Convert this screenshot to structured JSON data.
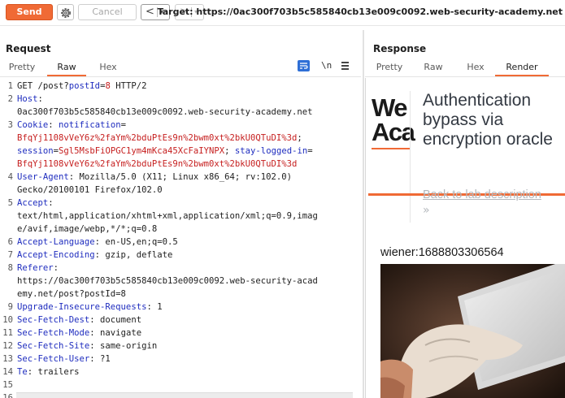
{
  "toolbar": {
    "send_label": "Send",
    "cancel_label": "Cancel",
    "back_arrow": "<",
    "forward_arrow": ">",
    "dropdown_caret": "▾",
    "target_text": "Target: https://0ac300f703b5c585840cb13e009c0092.web-security-academy.net"
  },
  "request": {
    "title": "Request",
    "tabs": [
      "Pretty",
      "Raw",
      "Hex"
    ],
    "active_tab": "Raw",
    "newline_toggle": "\\n",
    "lines": [
      {
        "num": "1",
        "parts": [
          [
            "GET /post?",
            ""
          ],
          [
            "postId",
            "pn"
          ],
          [
            "=",
            ""
          ],
          [
            "8",
            "pv"
          ],
          [
            " HTTP/2",
            ""
          ]
        ]
      },
      {
        "num": "2",
        "parts": [
          [
            "Host",
            "hn"
          ],
          [
            ":",
            ""
          ]
        ]
      },
      {
        "num": "",
        "parts": [
          [
            "0ac300f703b5c585840cb13e009c0092.web-security-academy.net",
            ""
          ]
        ]
      },
      {
        "num": "3",
        "parts": [
          [
            "Cookie",
            "hn"
          ],
          [
            ": ",
            ""
          ],
          [
            "notification",
            "ck"
          ],
          [
            "=",
            ""
          ]
        ]
      },
      {
        "num": "",
        "parts": [
          [
            "BfqYj1108vVeY6z%2faYm%2bduPtEs9n%2bwm0xt%2bkU0QTuDI%3d",
            "cv"
          ],
          [
            ";",
            ""
          ]
        ]
      },
      {
        "num": "",
        "parts": [
          [
            "session",
            "ck"
          ],
          [
            "=",
            ""
          ],
          [
            "Sgl5MsbFiOPGC1ym4mKca45XcFaIYNPX",
            "cv"
          ],
          [
            "; ",
            ""
          ],
          [
            "stay-logged-in",
            "ck"
          ],
          [
            "=",
            ""
          ]
        ]
      },
      {
        "num": "",
        "parts": [
          [
            "BfqYj1108vVeY6z%2faYm%2bduPtEs9n%2bwm0xt%2bkU0QTuDI%3d",
            "cv"
          ]
        ]
      },
      {
        "num": "4",
        "parts": [
          [
            "User-Agent",
            "hn"
          ],
          [
            ": Mozilla/5.0 (X11; Linux x86_64; rv:102.0)",
            ""
          ]
        ]
      },
      {
        "num": "",
        "parts": [
          [
            "Gecko/20100101 Firefox/102.0",
            ""
          ]
        ]
      },
      {
        "num": "5",
        "parts": [
          [
            "Accept",
            "hn"
          ],
          [
            ":",
            ""
          ]
        ]
      },
      {
        "num": "",
        "parts": [
          [
            "text/html,application/xhtml+xml,application/xml;q=0.9,imag",
            ""
          ]
        ]
      },
      {
        "num": "",
        "parts": [
          [
            "e/avif,image/webp,*/*;q=0.8",
            ""
          ]
        ]
      },
      {
        "num": "6",
        "parts": [
          [
            "Accept-Language",
            "hn"
          ],
          [
            ": en-US,en;q=0.5",
            ""
          ]
        ]
      },
      {
        "num": "7",
        "parts": [
          [
            "Accept-Encoding",
            "hn"
          ],
          [
            ": gzip, deflate",
            ""
          ]
        ]
      },
      {
        "num": "8",
        "parts": [
          [
            "Referer",
            "hn"
          ],
          [
            ":",
            ""
          ]
        ]
      },
      {
        "num": "",
        "parts": [
          [
            "https://0ac300f703b5c585840cb13e009c0092.web-security-acad",
            ""
          ]
        ]
      },
      {
        "num": "",
        "parts": [
          [
            "emy.net/post?postId=8",
            ""
          ]
        ]
      },
      {
        "num": "9",
        "parts": [
          [
            "Upgrade-Insecure-Requests",
            "hn"
          ],
          [
            ": 1",
            ""
          ]
        ]
      },
      {
        "num": "10",
        "parts": [
          [
            "Sec-Fetch-Dest",
            "hn"
          ],
          [
            ": document",
            ""
          ]
        ]
      },
      {
        "num": "11",
        "parts": [
          [
            "Sec-Fetch-Mode",
            "hn"
          ],
          [
            ": navigate",
            ""
          ]
        ]
      },
      {
        "num": "12",
        "parts": [
          [
            "Sec-Fetch-Site",
            "hn"
          ],
          [
            ": same-origin",
            ""
          ]
        ]
      },
      {
        "num": "13",
        "parts": [
          [
            "Sec-Fetch-User",
            "hn"
          ],
          [
            ": ?1",
            ""
          ]
        ]
      },
      {
        "num": "14",
        "parts": [
          [
            "Te",
            "hn"
          ],
          [
            ": trailers",
            ""
          ]
        ]
      },
      {
        "num": "15",
        "parts": []
      },
      {
        "num": "16",
        "parts": []
      }
    ]
  },
  "response": {
    "title": "Response",
    "tabs": [
      "Pretty",
      "Raw",
      "Hex",
      "Render"
    ],
    "active_tab": "Render",
    "render": {
      "logo_line1": "We",
      "logo_line2": "Aca",
      "lab_title": "Authentication bypass via encryption oracle",
      "back_link": "Back to lab description",
      "back_chevron": "»",
      "account_text": "wiener:1688803306564",
      "image_alt": "hand holding a tablet device"
    }
  },
  "colors": {
    "accent": "#f06a35",
    "header_name": "#1f2dbf",
    "value_red": "#c62020",
    "active_icon": "#2f6fd6"
  },
  "icons": [
    "gear-icon",
    "wrap-text-icon",
    "menu-icon",
    "chevron-left-icon",
    "chevron-right-icon"
  ]
}
